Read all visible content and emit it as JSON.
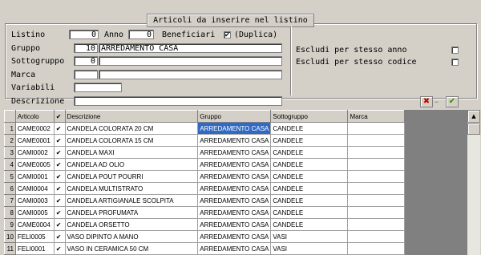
{
  "header": {
    "title": "Articoli da inserire nel listino"
  },
  "form": {
    "listino_label": "Listino",
    "listino_value": "0",
    "anno_label": "Anno",
    "anno_value": "0",
    "beneficiari_label": "Beneficiari",
    "beneficiari_checked": "✔",
    "duplica_label": "(Duplica)",
    "gruppo_label": "Gruppo",
    "gruppo_code": "10",
    "gruppo_name": "ARREDAMENTO CASA",
    "sottogruppo_label": "Sottogruppo",
    "sottogruppo_code": "0",
    "sottogruppo_name": "",
    "marca_label": "Marca",
    "marca_code": "",
    "marca_name": "",
    "variabili_label": "Variabili",
    "variabili_value": "",
    "descrizione_label": "Descrizione",
    "descrizione_value": ""
  },
  "options": {
    "escludi_anno_label": "Escludi per stesso anno",
    "escludi_codice_label": "Escludi per stesso codice",
    "escludi_anno_checked": "",
    "escludi_codice_checked": ""
  },
  "buttons": {
    "cancel_icon": "✖",
    "ellipsis": "…",
    "confirm_icon": "✔"
  },
  "colors": {
    "cancel": "#cc0000",
    "confirm": "#2e8b00",
    "selection": "#316ac5"
  },
  "table": {
    "columns": [
      "Articolo",
      "✔",
      "Descrizione",
      "Gruppo",
      "Sottogruppo",
      "Marca"
    ],
    "rows": [
      {
        "n": "1",
        "articolo": "CAME0002",
        "check": "✔",
        "descrizione": "CANDELA COLORATA 20 CM",
        "gruppo": "ARREDAMENTO CASA",
        "sottogruppo": "CANDELE",
        "marca": ""
      },
      {
        "n": "2",
        "articolo": "CAME0001",
        "check": "✔",
        "descrizione": "CANDELA COLORATA 15 CM",
        "gruppo": "ARREDAMENTO CASA",
        "sottogruppo": "CANDELE",
        "marca": ""
      },
      {
        "n": "3",
        "articolo": "CAMI0002",
        "check": "✔",
        "descrizione": "CANDELA MAXI",
        "gruppo": "ARREDAMENTO CASA",
        "sottogruppo": "CANDELE",
        "marca": ""
      },
      {
        "n": "4",
        "articolo": "CAME0005",
        "check": "✔",
        "descrizione": "CANDELA AD OLIO",
        "gruppo": "ARREDAMENTO CASA",
        "sottogruppo": "CANDELE",
        "marca": ""
      },
      {
        "n": "5",
        "articolo": "CAMI0001",
        "check": "✔",
        "descrizione": "CANDELA POUT POURRI",
        "gruppo": "ARREDAMENTO CASA",
        "sottogruppo": "CANDELE",
        "marca": ""
      },
      {
        "n": "6",
        "articolo": "CAMI0004",
        "check": "✔",
        "descrizione": "CANDELA MULTISTRATO",
        "gruppo": "ARREDAMENTO CASA",
        "sottogruppo": "CANDELE",
        "marca": ""
      },
      {
        "n": "7",
        "articolo": "CAMI0003",
        "check": "✔",
        "descrizione": "CANDELA ARTIGIANALE SCOLPITA",
        "gruppo": "ARREDAMENTO CASA",
        "sottogruppo": "CANDELE",
        "marca": ""
      },
      {
        "n": "8",
        "articolo": "CAMI0005",
        "check": "✔",
        "descrizione": "CANDELA PROFUMATA",
        "gruppo": "ARREDAMENTO CASA",
        "sottogruppo": "CANDELE",
        "marca": ""
      },
      {
        "n": "9",
        "articolo": "CAME0004",
        "check": "✔",
        "descrizione": "CANDELA ORSETTO",
        "gruppo": "ARREDAMENTO CASA",
        "sottogruppo": "CANDELE",
        "marca": ""
      },
      {
        "n": "10",
        "articolo": "FELI0005",
        "check": "✔",
        "descrizione": "VASO DIPINTO A MANO",
        "gruppo": "ARREDAMENTO CASA",
        "sottogruppo": "VASI",
        "marca": ""
      },
      {
        "n": "11",
        "articolo": "FELI0001",
        "check": "✔",
        "descrizione": "VASO IN CERAMICA 50 CM",
        "gruppo": "ARREDAMENTO CASA",
        "sottogruppo": "VASI",
        "marca": ""
      }
    ]
  }
}
